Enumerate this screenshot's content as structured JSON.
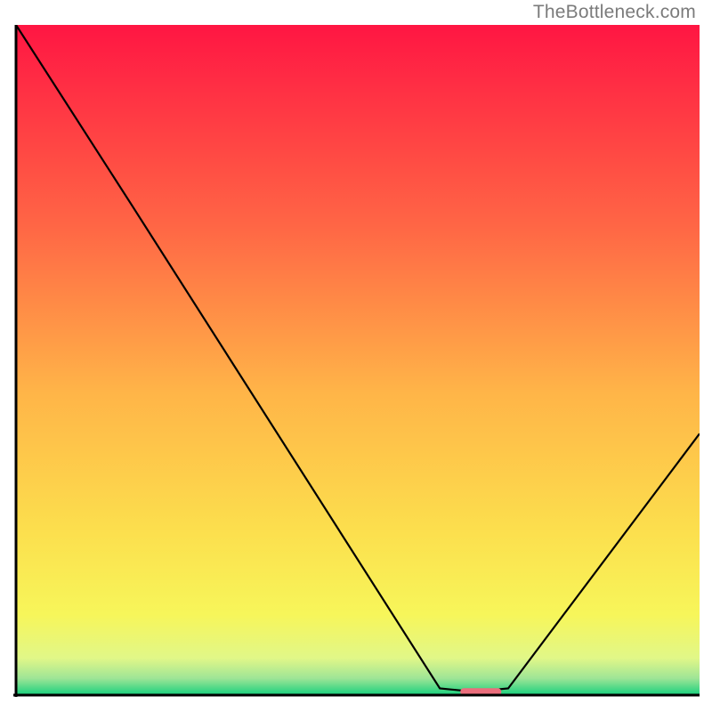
{
  "attribution": "TheBottleneck.com",
  "chart_data": {
    "type": "line",
    "title": "",
    "xlabel": "",
    "ylabel": "",
    "xlim": [
      0,
      100
    ],
    "ylim": [
      0,
      100
    ],
    "series": [
      {
        "name": "curve",
        "x": [
          0,
          17,
          62,
          67,
          72,
          100
        ],
        "y": [
          100,
          73,
          1.0,
          0.5,
          1.0,
          39
        ]
      }
    ],
    "marker": {
      "x_start": 65,
      "x_end": 71,
      "y": 0.5,
      "color": "#eb6e7c"
    },
    "background_gradient": {
      "type": "vertical",
      "stops": [
        {
          "offset": 0.0,
          "color": "#ff1643"
        },
        {
          "offset": 0.3,
          "color": "#ff6645"
        },
        {
          "offset": 0.55,
          "color": "#ffb548"
        },
        {
          "offset": 0.75,
          "color": "#fcde4d"
        },
        {
          "offset": 0.88,
          "color": "#f7f65a"
        },
        {
          "offset": 0.945,
          "color": "#e1f788"
        },
        {
          "offset": 0.975,
          "color": "#9ee596"
        },
        {
          "offset": 1.0,
          "color": "#17d07d"
        }
      ]
    },
    "axis_color": "#000000",
    "grid": false
  }
}
